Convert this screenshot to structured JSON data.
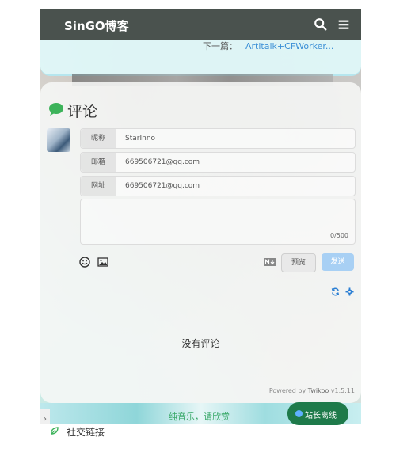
{
  "header": {
    "brand": "SinGO博客"
  },
  "next_post": {
    "label": "下一篇：",
    "title": "Artitalk+CFWorker..."
  },
  "comments": {
    "title": "评论",
    "fields": [
      {
        "label": "昵称",
        "value": "StarInno"
      },
      {
        "label": "邮箱",
        "value": "669506721@qq.com"
      },
      {
        "label": "网址",
        "value": "669506721@qq.com"
      }
    ],
    "counter": "0/500",
    "preview_label": "预览",
    "send_label": "发送",
    "empty_text": "没有评论",
    "powered_prefix": "Powered by ",
    "powered_name": "Twikoo",
    "powered_version": " v1.5.11"
  },
  "footer": {
    "music_text": "纯音乐，请欣赏",
    "side_arrow": "›",
    "social_label": "社交链接",
    "status_label": "站长离线"
  },
  "colors": {
    "header": "#4a524e",
    "status": "#1e7a4a",
    "link": "#3b8fd6"
  }
}
